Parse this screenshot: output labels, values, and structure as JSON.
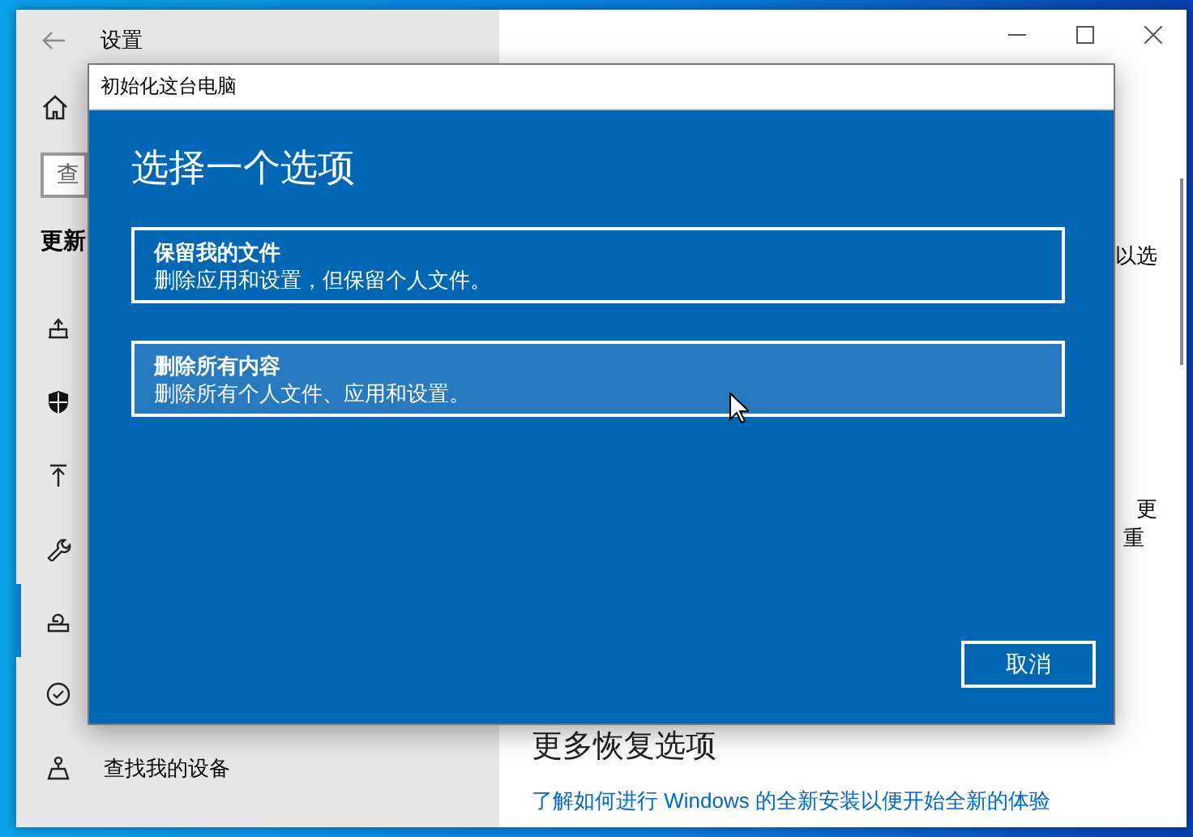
{
  "settings_window": {
    "title": "设置",
    "search": {
      "value": "查"
    },
    "section_heading": "更新",
    "nav_items": [
      {
        "selected": false
      },
      {
        "selected": false
      },
      {
        "selected": false
      },
      {
        "selected": false
      },
      {
        "selected": true
      },
      {
        "selected": false
      },
      {
        "selected": false,
        "label": "查找我的设备"
      }
    ],
    "right_pane": {
      "fragments": [
        "以选",
        "更",
        "重"
      ],
      "section_heading": "更多恢复选项",
      "link": "了解如何进行 Windows 的全新安装以便开始全新的体验"
    }
  },
  "dialog": {
    "title": "初始化这台电脑",
    "heading": "选择一个选项",
    "options": [
      {
        "title": "保留我的文件",
        "description": "删除应用和设置，但保留个人文件。",
        "hovered": false
      },
      {
        "title": "删除所有内容",
        "description": "删除所有个人文件、应用和设置。",
        "hovered": true
      }
    ],
    "cancel_button": "取消"
  }
}
